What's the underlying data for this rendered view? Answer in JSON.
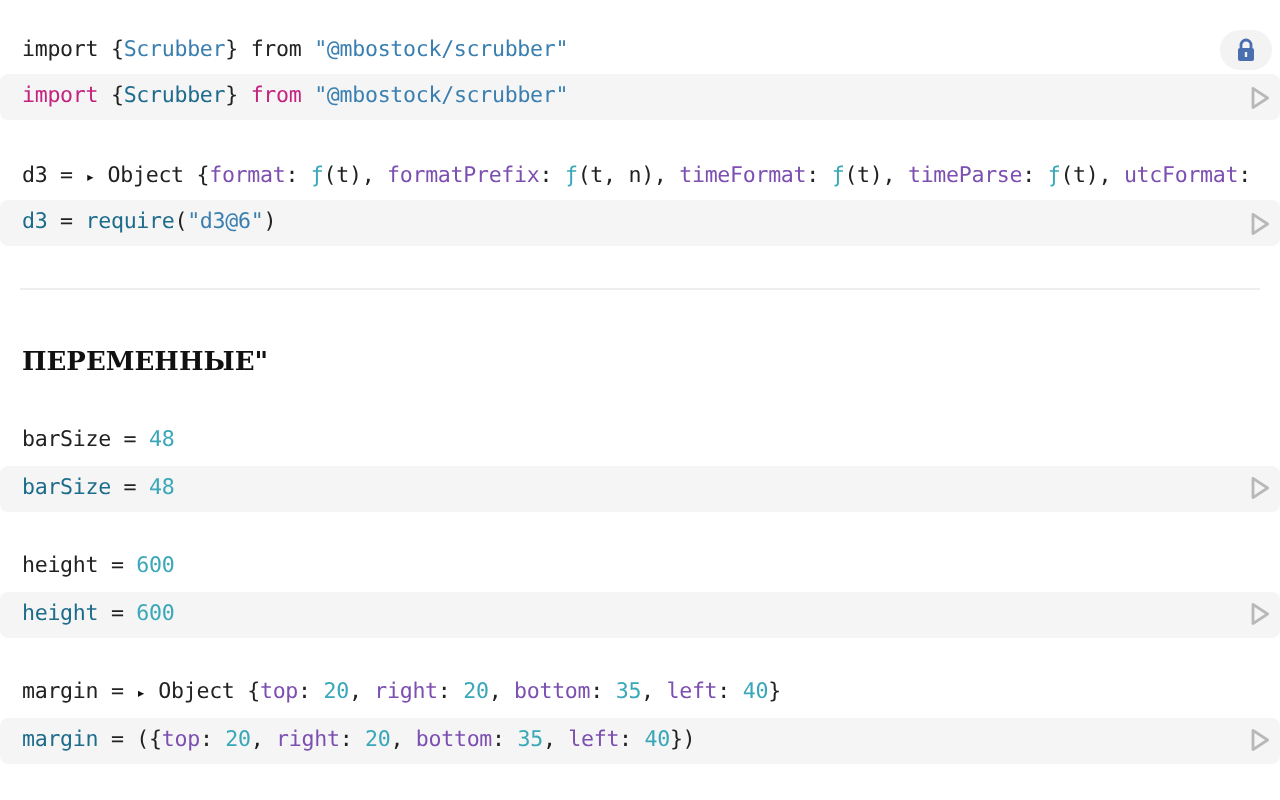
{
  "cells": [
    {
      "output": [
        {
          "text": "import ",
          "kind": "plain"
        },
        {
          "text": "{",
          "kind": "plain"
        },
        {
          "text": "Scrubber",
          "kind": "string"
        },
        {
          "text": "} from ",
          "kind": "plain"
        },
        {
          "text": "\"@mbostock/scrubber\"",
          "kind": "string"
        }
      ],
      "locked": true,
      "code": [
        {
          "text": "import",
          "kind": "keyword"
        },
        {
          "text": " {",
          "kind": "plain"
        },
        {
          "text": "Scrubber",
          "kind": "name"
        },
        {
          "text": "} ",
          "kind": "plain"
        },
        {
          "text": "from",
          "kind": "keyword"
        },
        {
          "text": " \"@mbostock/scrubber\"",
          "kind": "string"
        }
      ]
    },
    {
      "output": [
        {
          "text": "d3 = ",
          "kind": "plain"
        },
        {
          "text": "▸",
          "kind": "toggle"
        },
        {
          "text": " Object {",
          "kind": "plain"
        },
        {
          "text": "format",
          "kind": "property"
        },
        {
          "text": ": ",
          "kind": "plain"
        },
        {
          "text": "ƒ",
          "kind": "number"
        },
        {
          "text": "(t), ",
          "kind": "plain"
        },
        {
          "text": "formatPrefix",
          "kind": "property"
        },
        {
          "text": ": ",
          "kind": "plain"
        },
        {
          "text": "ƒ",
          "kind": "number"
        },
        {
          "text": "(t, n), ",
          "kind": "plain"
        },
        {
          "text": "timeFormat",
          "kind": "property"
        },
        {
          "text": ": ",
          "kind": "plain"
        },
        {
          "text": "ƒ",
          "kind": "number"
        },
        {
          "text": "(t), ",
          "kind": "plain"
        },
        {
          "text": "timeParse",
          "kind": "property"
        },
        {
          "text": ": ",
          "kind": "plain"
        },
        {
          "text": "ƒ",
          "kind": "number"
        },
        {
          "text": "(t), ",
          "kind": "plain"
        },
        {
          "text": "utcFormat",
          "kind": "property"
        },
        {
          "text": ":",
          "kind": "plain"
        }
      ],
      "locked": false,
      "code": [
        {
          "text": "d3",
          "kind": "name"
        },
        {
          "text": " = ",
          "kind": "plain"
        },
        {
          "text": "require",
          "kind": "name"
        },
        {
          "text": "(",
          "kind": "plain"
        },
        {
          "text": "\"d3@6\"",
          "kind": "string"
        },
        {
          "text": ")",
          "kind": "plain"
        }
      ]
    },
    {
      "heading": "ПЕРЕМЕННЫЕ\""
    },
    {
      "output": [
        {
          "text": "barSize = ",
          "kind": "plain"
        },
        {
          "text": "48",
          "kind": "number"
        }
      ],
      "locked": false,
      "code": [
        {
          "text": "barSize",
          "kind": "name"
        },
        {
          "text": " = ",
          "kind": "plain"
        },
        {
          "text": "48",
          "kind": "number"
        }
      ]
    },
    {
      "output": [
        {
          "text": "height = ",
          "kind": "plain"
        },
        {
          "text": "600",
          "kind": "number"
        }
      ],
      "locked": false,
      "code": [
        {
          "text": "height",
          "kind": "name"
        },
        {
          "text": " = ",
          "kind": "plain"
        },
        {
          "text": "600",
          "kind": "number"
        }
      ]
    },
    {
      "output": [
        {
          "text": "margin = ",
          "kind": "plain"
        },
        {
          "text": "▸",
          "kind": "toggle"
        },
        {
          "text": " Object {",
          "kind": "plain"
        },
        {
          "text": "top",
          "kind": "property"
        },
        {
          "text": ": ",
          "kind": "plain"
        },
        {
          "text": "20",
          "kind": "number"
        },
        {
          "text": ", ",
          "kind": "plain"
        },
        {
          "text": "right",
          "kind": "property"
        },
        {
          "text": ": ",
          "kind": "plain"
        },
        {
          "text": "20",
          "kind": "number"
        },
        {
          "text": ", ",
          "kind": "plain"
        },
        {
          "text": "bottom",
          "kind": "property"
        },
        {
          "text": ": ",
          "kind": "plain"
        },
        {
          "text": "35",
          "kind": "number"
        },
        {
          "text": ", ",
          "kind": "plain"
        },
        {
          "text": "left",
          "kind": "property"
        },
        {
          "text": ": ",
          "kind": "plain"
        },
        {
          "text": "40",
          "kind": "number"
        },
        {
          "text": "}",
          "kind": "plain"
        }
      ],
      "locked": false,
      "code": [
        {
          "text": "margin",
          "kind": "name"
        },
        {
          "text": " = ({",
          "kind": "plain"
        },
        {
          "text": "top",
          "kind": "property"
        },
        {
          "text": ": ",
          "kind": "plain"
        },
        {
          "text": "20",
          "kind": "number"
        },
        {
          "text": ", ",
          "kind": "plain"
        },
        {
          "text": "right",
          "kind": "property"
        },
        {
          "text": ": ",
          "kind": "plain"
        },
        {
          "text": "20",
          "kind": "number"
        },
        {
          "text": ", ",
          "kind": "plain"
        },
        {
          "text": "bottom",
          "kind": "property"
        },
        {
          "text": ": ",
          "kind": "plain"
        },
        {
          "text": "35",
          "kind": "number"
        },
        {
          "text": ", ",
          "kind": "plain"
        },
        {
          "text": "left",
          "kind": "property"
        },
        {
          "text": ": ",
          "kind": "plain"
        },
        {
          "text": "40",
          "kind": "number"
        },
        {
          "text": "})",
          "kind": "plain"
        }
      ]
    }
  ]
}
